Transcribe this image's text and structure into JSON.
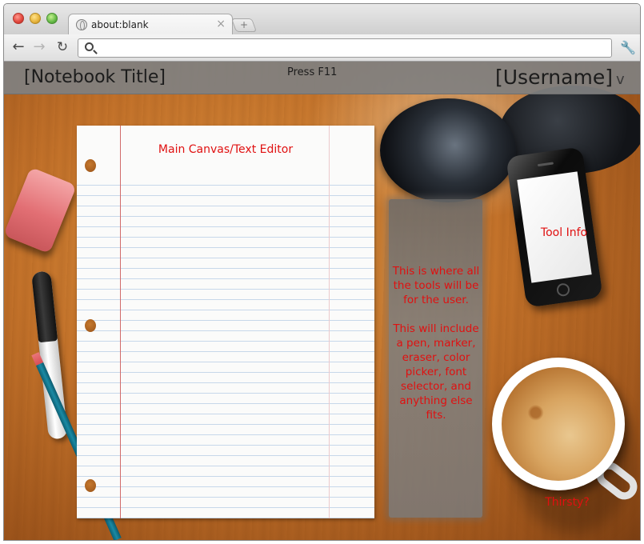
{
  "browser": {
    "tab_title": "about:blank",
    "tab_close": "×",
    "new_tab": "+",
    "back_icon": "←",
    "forward_icon": "→",
    "reload_icon": "↻",
    "wrench_icon": "🔧",
    "address_value": "",
    "address_placeholder": ""
  },
  "app": {
    "notebook_title": "[Notebook Title]",
    "hint": "Press F11",
    "username": "[Username]",
    "user_menu_caret": "v"
  },
  "canvas": {
    "label": "Main Canvas/Text Editor"
  },
  "tools_panel": {
    "line1": "This is where all the tools will be for the user.",
    "line2": "This will include a pen, marker, eraser, color picker, font selector, and anything else fits."
  },
  "phone": {
    "label": "Tool Info"
  },
  "mug": {
    "label": "Thirsty?"
  },
  "colors": {
    "annotation_red": "#e01010",
    "topbar_gray": "#808080",
    "desk_wood": "#c3722a"
  }
}
